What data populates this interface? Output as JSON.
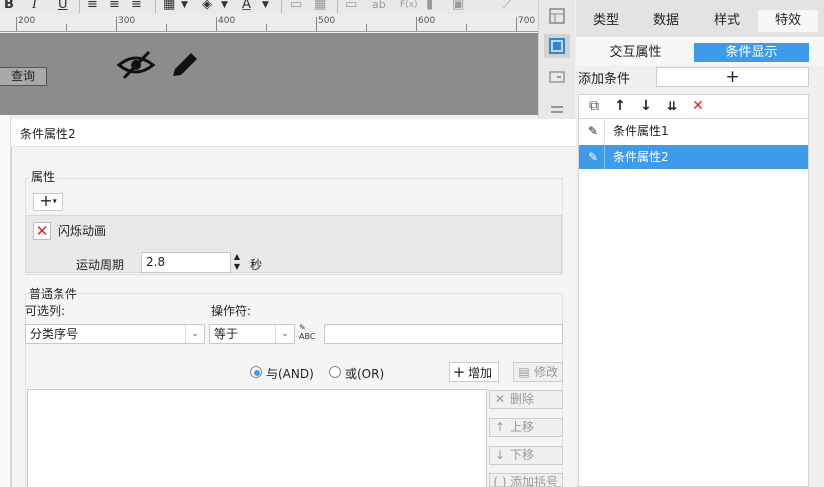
{
  "toolbar": {
    "bold": "B",
    "italic": "I",
    "underline": "U",
    "text_color": "A",
    "insert_label_ab": "ab",
    "formula": "F(x)"
  },
  "ruler": {
    "ticks": [
      "200",
      "300",
      "400",
      "500",
      "600",
      "700"
    ]
  },
  "canvas": {
    "query_button": "查询"
  },
  "right_panel": {
    "tabs": [
      "类型",
      "数据",
      "样式",
      "特效"
    ],
    "active_tab": "特效",
    "subtabs": [
      "交互属性",
      "条件显示"
    ],
    "active_subtab": "条件显示",
    "add_condition_label": "添加条件",
    "add_condition_plus": "+",
    "conditions": [
      "条件属性1",
      "条件属性2"
    ],
    "selected_condition": "条件属性2"
  },
  "dialog": {
    "title": "条件属性2",
    "attributes_label": "属性",
    "add_attr": "+",
    "animation_name": "闪烁动画",
    "period_label": "运动周期",
    "period_value": "2.8",
    "period_unit": "秒",
    "normal_condition_label": "普通条件",
    "optional_column_label": "可选列:",
    "column_value": "分类序号",
    "operator_label": "操作符:",
    "operator_value": "等于",
    "value_input": "",
    "and_label": "与(AND)",
    "or_label": "或(OR)",
    "add_button": "增加",
    "modify_button": "修改",
    "delete_button": "删除",
    "move_up_button": "上移",
    "move_down_button": "下移",
    "add_bracket_button": "添加括号"
  },
  "colors": {
    "accent": "#3d9bea",
    "danger": "#e02020",
    "canvas": "#8c8c8c"
  }
}
